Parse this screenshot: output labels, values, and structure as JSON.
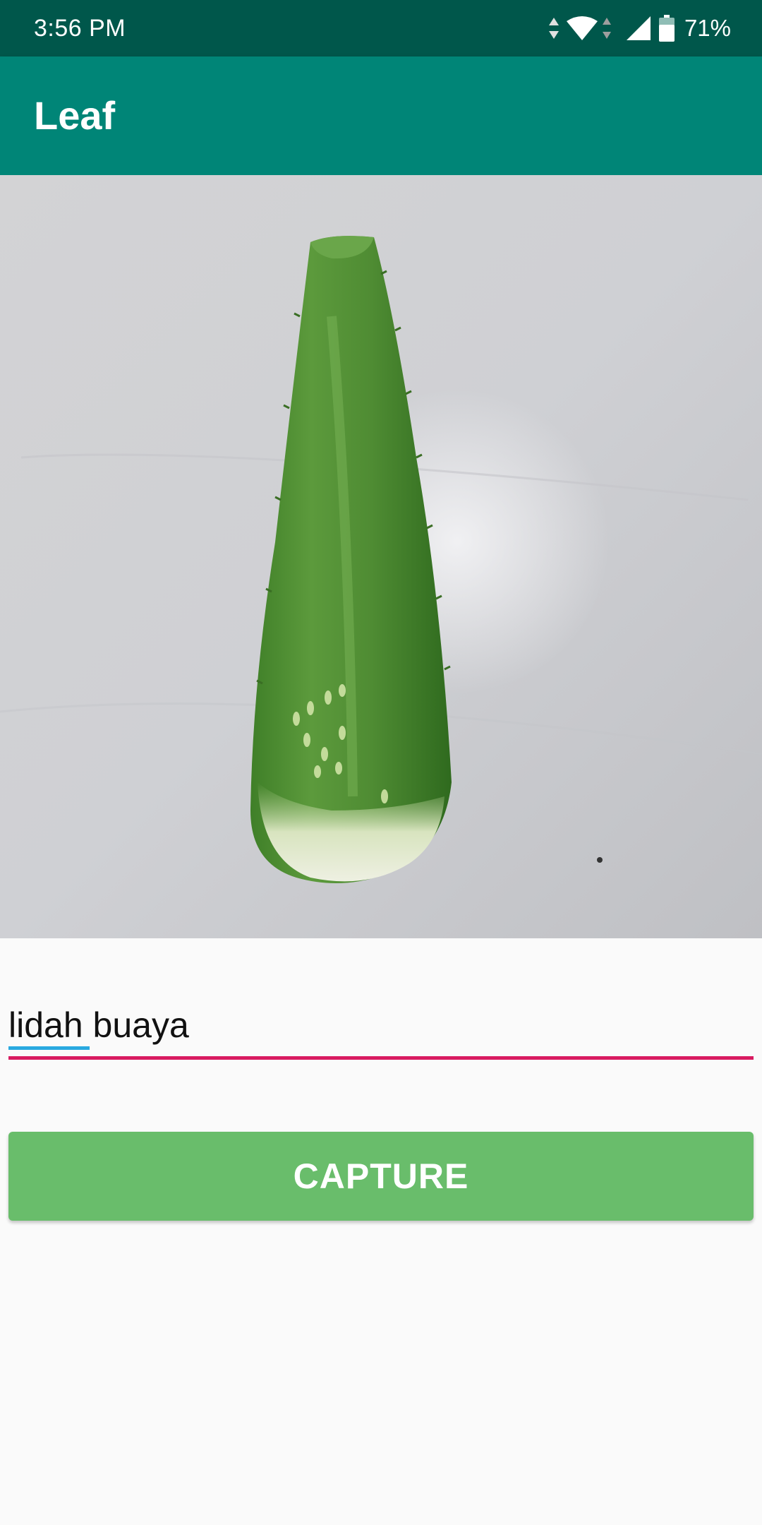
{
  "status_bar": {
    "time": "3:56 PM",
    "battery_percent": "71%",
    "background_color": "#00574b",
    "icons": [
      "data-arrows-icon",
      "wifi-icon",
      "cell-signal-icon",
      "battery-icon"
    ]
  },
  "app_bar": {
    "title": "Leaf",
    "background_color": "#008577"
  },
  "photo": {
    "subject": "aloe-vera-leaf-image"
  },
  "name_field": {
    "value": "lidah buaya",
    "underline_color": "#d81b60"
  },
  "capture_button": {
    "label": "CAPTURE",
    "color": "#69bd6b"
  }
}
